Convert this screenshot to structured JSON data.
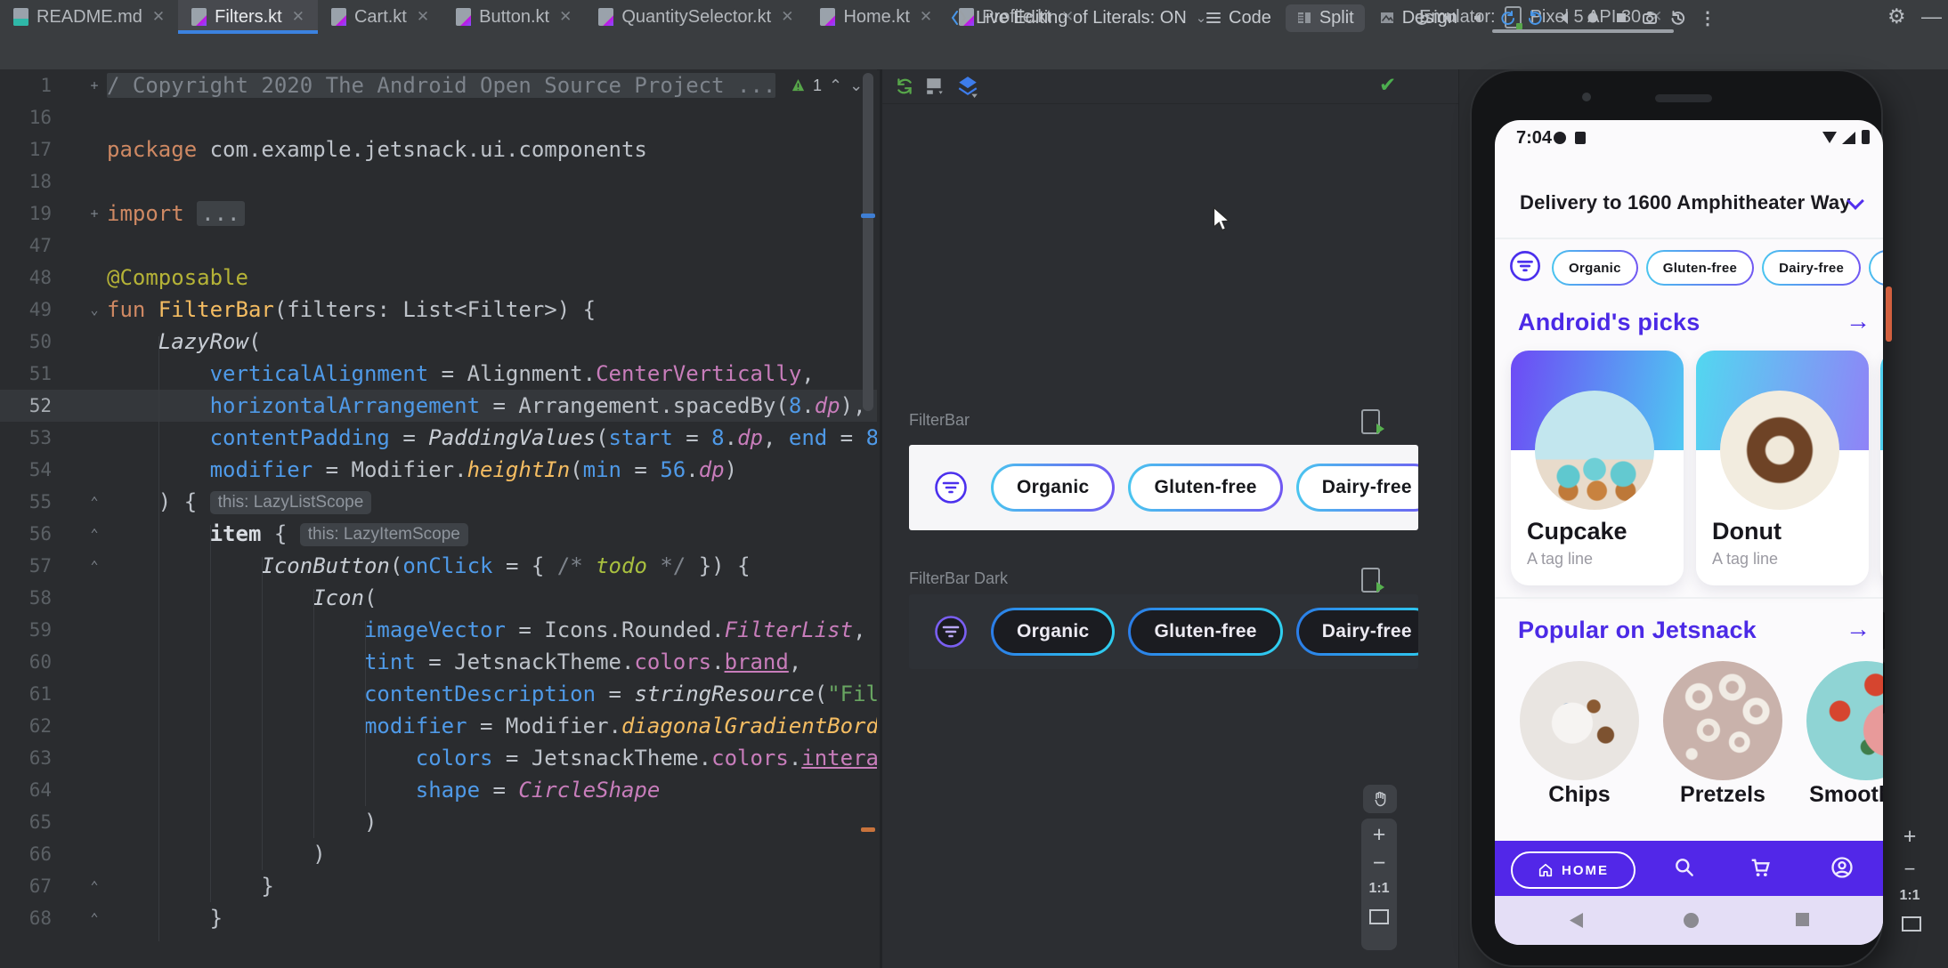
{
  "window": {
    "tabs": [
      {
        "label": "README.md",
        "icon": "md",
        "active": false
      },
      {
        "label": "Filters.kt",
        "icon": "kt",
        "active": true
      },
      {
        "label": "Cart.kt",
        "icon": "kt",
        "active": false
      },
      {
        "label": "Button.kt",
        "icon": "kt",
        "active": false
      },
      {
        "label": "QuantitySelector.kt",
        "icon": "kt",
        "active": false
      },
      {
        "label": "Home.kt",
        "icon": "kt",
        "active": false
      },
      {
        "label": "Profile.kt",
        "icon": "kt",
        "active": false
      }
    ],
    "emulator_label": "Emulator:",
    "emulator_tab": "Pixel 5 API 30"
  },
  "toolbar": {
    "live_editing": "Live Editing of Literals: ON",
    "code_label": "Code",
    "split_label": "Split",
    "design_label": "Design"
  },
  "editor": {
    "inspection_count": "1",
    "lines": [
      {
        "n": "1",
        "marker": "+",
        "foldbg": true,
        "seg": [
          [
            "cmt",
            "/ Copyright 2020 The Android Open Source Project ..."
          ]
        ]
      },
      {
        "n": "16",
        "seg": []
      },
      {
        "n": "17",
        "seg": [
          [
            "kw",
            "package"
          ],
          [
            "plain",
            " com.example.jetsnack.ui.components"
          ]
        ]
      },
      {
        "n": "18",
        "seg": []
      },
      {
        "n": "19",
        "marker": "+",
        "seg": [
          [
            "kw",
            "import"
          ],
          [
            "plain",
            " "
          ],
          [
            "fold",
            "..."
          ]
        ]
      },
      {
        "n": "47",
        "seg": []
      },
      {
        "n": "48",
        "seg": [
          [
            "ann",
            "@Composable"
          ]
        ]
      },
      {
        "n": "49",
        "marker": "⌄",
        "seg": [
          [
            "kw",
            "fun "
          ],
          [
            "fn",
            "FilterBar"
          ],
          [
            "plain",
            "(filters: List<Filter>) {"
          ]
        ]
      },
      {
        "n": "50",
        "seg": [
          [
            "plain",
            "    "
          ],
          [
            "call",
            "LazyRow"
          ],
          [
            "plain",
            "("
          ]
        ]
      },
      {
        "n": "51",
        "seg": [
          [
            "plain",
            "        "
          ],
          [
            "par",
            "verticalAlignment"
          ],
          [
            "plain",
            " = Alignment."
          ],
          [
            "prop",
            "CenterVertically"
          ],
          [
            "plain",
            ","
          ]
        ]
      },
      {
        "n": "52",
        "hl": true,
        "seg": [
          [
            "plain",
            "        "
          ],
          [
            "par",
            "horizontalArrangement"
          ],
          [
            "plain",
            " = Arrangement.spacedBy("
          ],
          [
            "num",
            "8"
          ],
          [
            "plain",
            "."
          ],
          [
            "propi",
            "dp"
          ],
          [
            "plain",
            "),"
          ]
        ]
      },
      {
        "n": "53",
        "seg": [
          [
            "plain",
            "        "
          ],
          [
            "par",
            "contentPadding"
          ],
          [
            "plain",
            " = "
          ],
          [
            "call",
            "PaddingValues"
          ],
          [
            "plain",
            "("
          ],
          [
            "par",
            "start"
          ],
          [
            "plain",
            " = "
          ],
          [
            "num",
            "8"
          ],
          [
            "plain",
            "."
          ],
          [
            "propi",
            "dp"
          ],
          [
            "plain",
            ", "
          ],
          [
            "par",
            "end"
          ],
          [
            "plain",
            " = "
          ],
          [
            "num",
            "8"
          ],
          [
            "plain",
            "."
          ],
          [
            "propi",
            "dp"
          ],
          [
            "plain",
            "),"
          ]
        ]
      },
      {
        "n": "54",
        "seg": [
          [
            "plain",
            "        "
          ],
          [
            "par",
            "modifier"
          ],
          [
            "plain",
            " = Modifier."
          ],
          [
            "fni",
            "heightIn"
          ],
          [
            "plain",
            "("
          ],
          [
            "par",
            "min"
          ],
          [
            "plain",
            " = "
          ],
          [
            "num",
            "56"
          ],
          [
            "plain",
            "."
          ],
          [
            "propi",
            "dp"
          ],
          [
            "plain",
            ")"
          ]
        ]
      },
      {
        "n": "55",
        "marker": "⌃",
        "seg": [
          [
            "plain",
            "    ) { "
          ],
          [
            "hint",
            "this: LazyListScope"
          ]
        ]
      },
      {
        "n": "56",
        "marker": "⌃",
        "seg": [
          [
            "plain",
            "        "
          ],
          [
            "bold",
            "item"
          ],
          [
            "plain",
            " { "
          ],
          [
            "hint",
            "this: LazyItemScope"
          ]
        ]
      },
      {
        "n": "57",
        "marker": "⌃",
        "seg": [
          [
            "plain",
            "            "
          ],
          [
            "call",
            "IconButton"
          ],
          [
            "plain",
            "("
          ],
          [
            "par",
            "onClick"
          ],
          [
            "plain",
            " = { "
          ],
          [
            "cmt",
            "/* "
          ],
          [
            "todo",
            "todo"
          ],
          [
            "cmt",
            " */"
          ],
          [
            "plain",
            " }) {"
          ]
        ]
      },
      {
        "n": "58",
        "seg": [
          [
            "plain",
            "                "
          ],
          [
            "call",
            "Icon"
          ],
          [
            "plain",
            "("
          ]
        ]
      },
      {
        "n": "59",
        "seg": [
          [
            "plain",
            "                    "
          ],
          [
            "par",
            "imageVector"
          ],
          [
            "plain",
            " = Icons.Rounded."
          ],
          [
            "propi",
            "FilterList"
          ],
          [
            "plain",
            ","
          ]
        ]
      },
      {
        "n": "60",
        "seg": [
          [
            "plain",
            "                    "
          ],
          [
            "par",
            "tint"
          ],
          [
            "plain",
            " = JetsnackTheme."
          ],
          [
            "prop",
            "colors"
          ],
          [
            "plain",
            "."
          ],
          [
            "propu",
            "brand"
          ],
          [
            "plain",
            ","
          ]
        ]
      },
      {
        "n": "61",
        "seg": [
          [
            "plain",
            "                    "
          ],
          [
            "par",
            "contentDescription"
          ],
          [
            "plain",
            " = "
          ],
          [
            "call",
            "stringResource"
          ],
          [
            "plain",
            "("
          ],
          [
            "str",
            "\"Fil"
          ]
        ]
      },
      {
        "n": "62",
        "seg": [
          [
            "plain",
            "                    "
          ],
          [
            "par",
            "modifier"
          ],
          [
            "plain",
            " = Modifier."
          ],
          [
            "fni",
            "diagonalGradientBorder"
          ],
          [
            "plain",
            "("
          ]
        ]
      },
      {
        "n": "63",
        "seg": [
          [
            "plain",
            "                        "
          ],
          [
            "par",
            "colors"
          ],
          [
            "plain",
            " = JetsnackTheme."
          ],
          [
            "prop",
            "colors"
          ],
          [
            "plain",
            "."
          ],
          [
            "propu",
            "interactive"
          ]
        ]
      },
      {
        "n": "64",
        "seg": [
          [
            "plain",
            "                        "
          ],
          [
            "par",
            "shape"
          ],
          [
            "plain",
            " = "
          ],
          [
            "propi",
            "CircleShape"
          ]
        ]
      },
      {
        "n": "65",
        "seg": [
          [
            "plain",
            "                    )"
          ]
        ]
      },
      {
        "n": "66",
        "seg": [
          [
            "plain",
            "                )"
          ]
        ]
      },
      {
        "n": "67",
        "marker": "⌃",
        "seg": [
          [
            "plain",
            "            }"
          ]
        ]
      },
      {
        "n": "68",
        "marker": "⌃",
        "seg": [
          [
            "plain",
            "        }"
          ]
        ]
      }
    ]
  },
  "preview": {
    "groups": [
      {
        "title": "FilterBar",
        "chips": [
          "Organic",
          "Gluten-free",
          "Dairy-free"
        ]
      },
      {
        "title": "FilterBar Dark",
        "chips": [
          "Organic",
          "Gluten-free",
          "Dairy-free"
        ]
      }
    ],
    "zoom_label": "1:1"
  },
  "emulator": {
    "status_time": "7:04",
    "delivery": "Delivery to 1600 Amphitheater Way",
    "chips": [
      "Organic",
      "Gluten-free",
      "Dairy-free"
    ],
    "sections": [
      {
        "title": "Android's picks",
        "arrow": "→",
        "cards": [
          {
            "name": "Cupcake",
            "tag": "A tag line"
          },
          {
            "name": "Donut",
            "tag": "A tag line"
          }
        ]
      },
      {
        "title": "Popular on Jetsnack",
        "arrow": "→",
        "items": [
          {
            "name": "Chips"
          },
          {
            "name": "Pretzels"
          },
          {
            "name": "Smoothies"
          }
        ]
      }
    ],
    "home_label": "HOME",
    "zoom_label": "1:1"
  },
  "colors": {
    "brand_purple": "#4b2ae6",
    "bottom_bar": "#5227e8",
    "accent_blue": "#3b82e0",
    "chip_gradient_light": [
      "#49c5ef",
      "#7156f2"
    ],
    "chip_gradient_dark": [
      "#2b7de8",
      "#2fd0f0"
    ]
  }
}
